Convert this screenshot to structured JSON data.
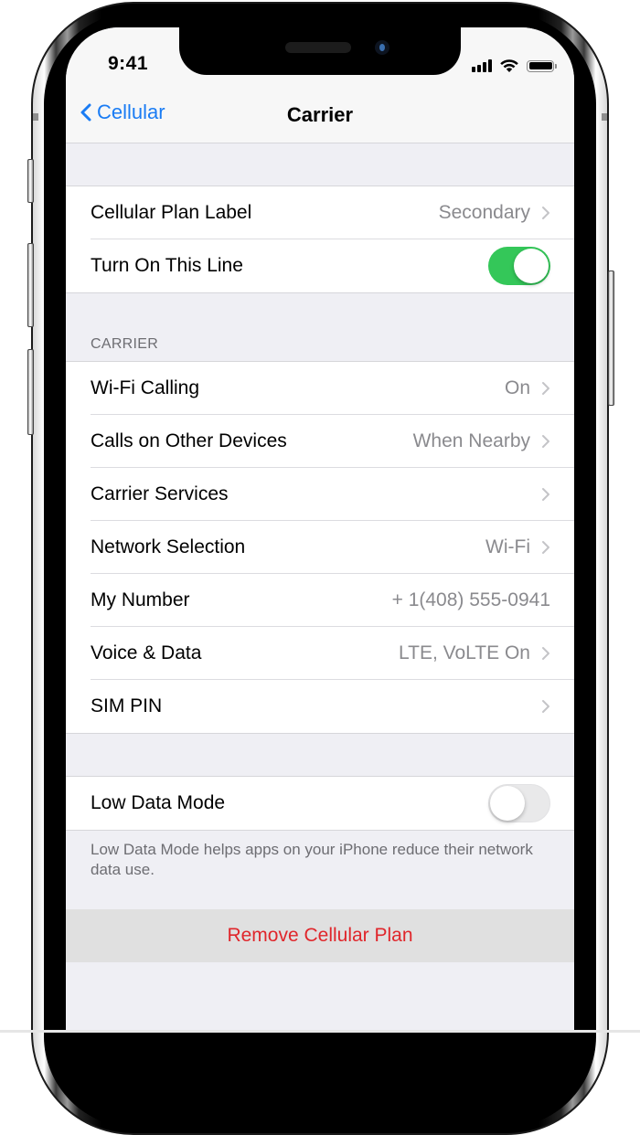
{
  "status_bar": {
    "time": "9:41",
    "icons": [
      "cellular-signal-icon",
      "wifi-icon",
      "battery-icon"
    ]
  },
  "nav": {
    "back_label": "Cellular",
    "title": "Carrier"
  },
  "plan_group": {
    "rows": [
      {
        "label": "Cellular Plan Label",
        "value": "Secondary",
        "has_chevron": true
      },
      {
        "label": "Turn On This Line",
        "toggle": "on"
      }
    ]
  },
  "carrier_section": {
    "header": "CARRIER",
    "rows": [
      {
        "label": "Wi-Fi Calling",
        "value": "On",
        "has_chevron": true
      },
      {
        "label": "Calls on Other Devices",
        "value": "When Nearby",
        "has_chevron": true
      },
      {
        "label": "Carrier Services",
        "value": "",
        "has_chevron": true
      },
      {
        "label": "Network Selection",
        "value": "Wi-Fi",
        "has_chevron": true
      },
      {
        "label": "My Number",
        "value": "+ 1(408) 555-0941",
        "has_chevron": false
      },
      {
        "label": "Voice & Data",
        "value": "LTE, VoLTE On",
        "has_chevron": true
      },
      {
        "label": "SIM PIN",
        "value": "",
        "has_chevron": true
      }
    ]
  },
  "low_data_group": {
    "label": "Low Data Mode",
    "toggle": "off",
    "footer": "Low Data Mode helps apps on your iPhone reduce their network data use."
  },
  "remove_plan": {
    "label": "Remove Cellular Plan"
  },
  "colors": {
    "accent_blue": "#1a7cf4",
    "toggle_on_green": "#34c759",
    "destructive_red": "#e0262b",
    "grouped_background": "#efeff4",
    "secondary_text": "#8a8a8e"
  }
}
